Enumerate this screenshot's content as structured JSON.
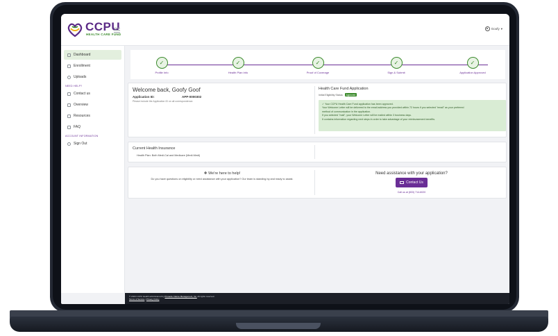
{
  "header": {
    "logo_text": "CCPU",
    "logo_subtitle": "HEALTH CARE FUND",
    "user_name": "Goofy",
    "user_caret": "▾"
  },
  "sidebar": {
    "items_main": [
      {
        "label": "Dashboard",
        "icon": "grid-icon"
      },
      {
        "label": "Enrollment",
        "icon": "document-icon"
      },
      {
        "label": "Uploads",
        "icon": "cloud-icon"
      }
    ],
    "heading_help": "NEED HELP?",
    "items_help": [
      {
        "label": "Contact us",
        "icon": "mail-icon"
      },
      {
        "label": "Overview",
        "icon": "external-link-icon"
      },
      {
        "label": "Resources",
        "icon": "external-link-icon"
      },
      {
        "label": "FAQ",
        "icon": "external-link-icon"
      }
    ],
    "heading_account": "ACCOUNT INFORMATION",
    "items_account": [
      {
        "label": "Sign Out",
        "icon": "sign-out-icon"
      }
    ]
  },
  "stepper": {
    "check_glyph": "✓",
    "steps": [
      {
        "label": "Profile Info"
      },
      {
        "label": "Health Plan Info"
      },
      {
        "label": "Proof of Coverage"
      },
      {
        "label": "Sign & Submit"
      },
      {
        "label": "Application Approved"
      }
    ]
  },
  "welcome": {
    "title": "Welcome back, Goofy Goof",
    "app_id_label": "Application ID:",
    "app_id_value": "APP-0000302",
    "note": "Please include the Application ID on all correspondence."
  },
  "application": {
    "title": "Health Care Fund Application",
    "eligibility_label": "Initial Eligibility Status:",
    "eligibility_badge": "Approved",
    "approval_lines": [
      "✓ Your CCPU Health Care Fund application has been approved.",
      "Your Welcome Letter will be delivered to the email address you provided within 72 hours if you selected \"email\" as your preferred",
      "method of communication in the application.",
      "If you selected \"mail\", your Welcome Letter will be mailed within 3 business days.",
      "It contains information regarding next steps in order to take advantage of your reimbursement benefits."
    ]
  },
  "insurance": {
    "title": "Current Health Insurance",
    "plan": "Health Plan: Both Medi-Cal and Medicare (Medi-Medi)"
  },
  "help": {
    "title": "❖ We're here to help!",
    "body": "Do you have questions on eligibility or need assistance with your application? Our team is standing by and ready to assist.",
    "assist_title": "Need assistance with your application?",
    "contact_button": "Contact Us",
    "call_text": "Call us at (833) 714-6020"
  },
  "footer": {
    "copyright_prefix": "© 2023 CCPU Health administered by ",
    "company_link": "Pinnacle Claims Management, Inc.",
    "copyright_suffix": " All rights reserved.",
    "terms_link": "Terms of Service",
    "separator": " | ",
    "privacy_link": "Privacy Policy"
  },
  "colors": {
    "brand_purple": "#6a2e96",
    "brand_green": "#3a8a2b",
    "approval_bg": "#d9ecd4"
  }
}
